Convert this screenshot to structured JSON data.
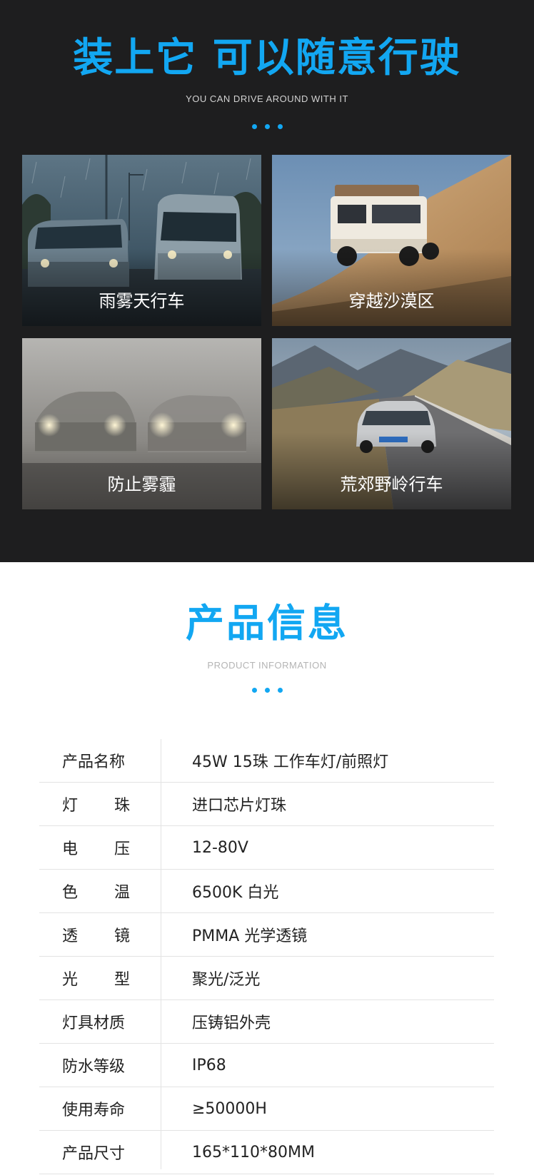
{
  "top": {
    "title": "装上它 可以随意行驶",
    "subtitle": "YOU CAN DRIVE AROUND WITH IT"
  },
  "scenes": [
    {
      "label": "雨雾天行车"
    },
    {
      "label": "穿越沙漠区"
    },
    {
      "label": "防止雾霾"
    },
    {
      "label": "荒郊野岭行车"
    }
  ],
  "info": {
    "title": "产品信息",
    "subtitle": "PRODUCT INFORMATION"
  },
  "specs": [
    {
      "key_a": "产品名称",
      "key_b": "",
      "value": "45W 15珠 工作车灯/前照灯"
    },
    {
      "key_a": "灯",
      "key_b": "珠",
      "value": "进口芯片灯珠"
    },
    {
      "key_a": "电",
      "key_b": "压",
      "value": "12-80V"
    },
    {
      "key_a": "色",
      "key_b": "温",
      "value": "6500K 白光"
    },
    {
      "key_a": "透",
      "key_b": "镜",
      "value": "PMMA 光学透镜"
    },
    {
      "key_a": "光",
      "key_b": "型",
      "value": "聚光/泛光"
    },
    {
      "key_a": "灯具材质",
      "key_b": "",
      "value": "压铸铝外壳"
    },
    {
      "key_a": "防水等级",
      "key_b": "",
      "value": "IP68"
    },
    {
      "key_a": "使用寿命",
      "key_b": "",
      "value": "≥50000H"
    },
    {
      "key_a": "产品尺寸",
      "key_b": "",
      "value": "165*110*80MM"
    }
  ],
  "colors": {
    "accent": "#12a7f2",
    "dark_bg": "#1e1e1f"
  }
}
